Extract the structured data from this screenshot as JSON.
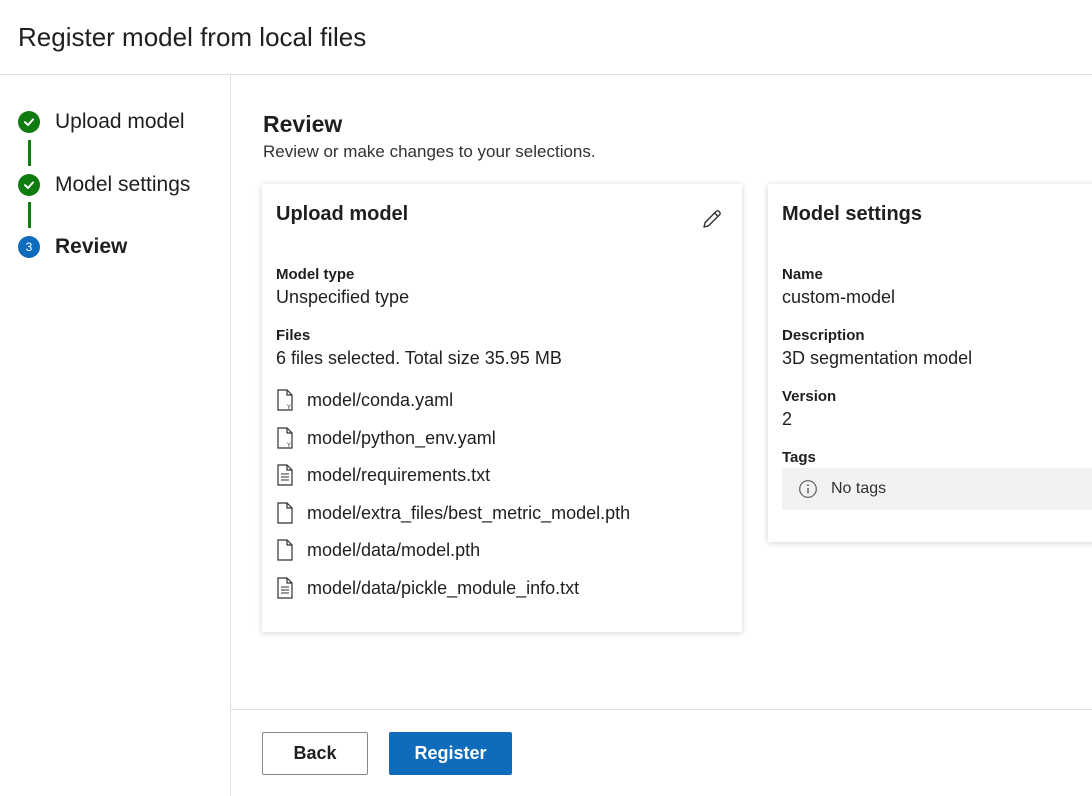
{
  "header": {
    "title": "Register model from local files"
  },
  "steps": [
    {
      "label": "Upload model",
      "status": "complete"
    },
    {
      "label": "Model settings",
      "status": "complete"
    },
    {
      "label": "Review",
      "status": "current",
      "number": "3"
    }
  ],
  "review": {
    "title": "Review",
    "subtitle": "Review or make changes to your selections."
  },
  "upload_card": {
    "title": "Upload model",
    "model_type_label": "Model type",
    "model_type_value": "Unspecified type",
    "files_label": "Files",
    "files_summary": "6 files selected. Total size 35.95 MB",
    "files": [
      {
        "name": "model/conda.yaml",
        "icon": "yaml-file-icon"
      },
      {
        "name": "model/python_env.yaml",
        "icon": "yaml-file-icon"
      },
      {
        "name": "model/requirements.txt",
        "icon": "text-file-icon"
      },
      {
        "name": "model/extra_files/best_metric_model.pth",
        "icon": "file-icon"
      },
      {
        "name": "model/data/model.pth",
        "icon": "file-icon"
      },
      {
        "name": "model/data/pickle_module_info.txt",
        "icon": "text-file-icon"
      }
    ]
  },
  "settings_card": {
    "title": "Model settings",
    "name_label": "Name",
    "name_value": "custom-model",
    "description_label": "Description",
    "description_value": "3D segmentation model",
    "version_label": "Version",
    "version_value": "2",
    "tags_label": "Tags",
    "tags_empty": "No tags"
  },
  "footer": {
    "back_label": "Back",
    "register_label": "Register"
  },
  "colors": {
    "primary": "#0f6cbd",
    "success": "#107c10",
    "border": "#e1dfdd"
  }
}
